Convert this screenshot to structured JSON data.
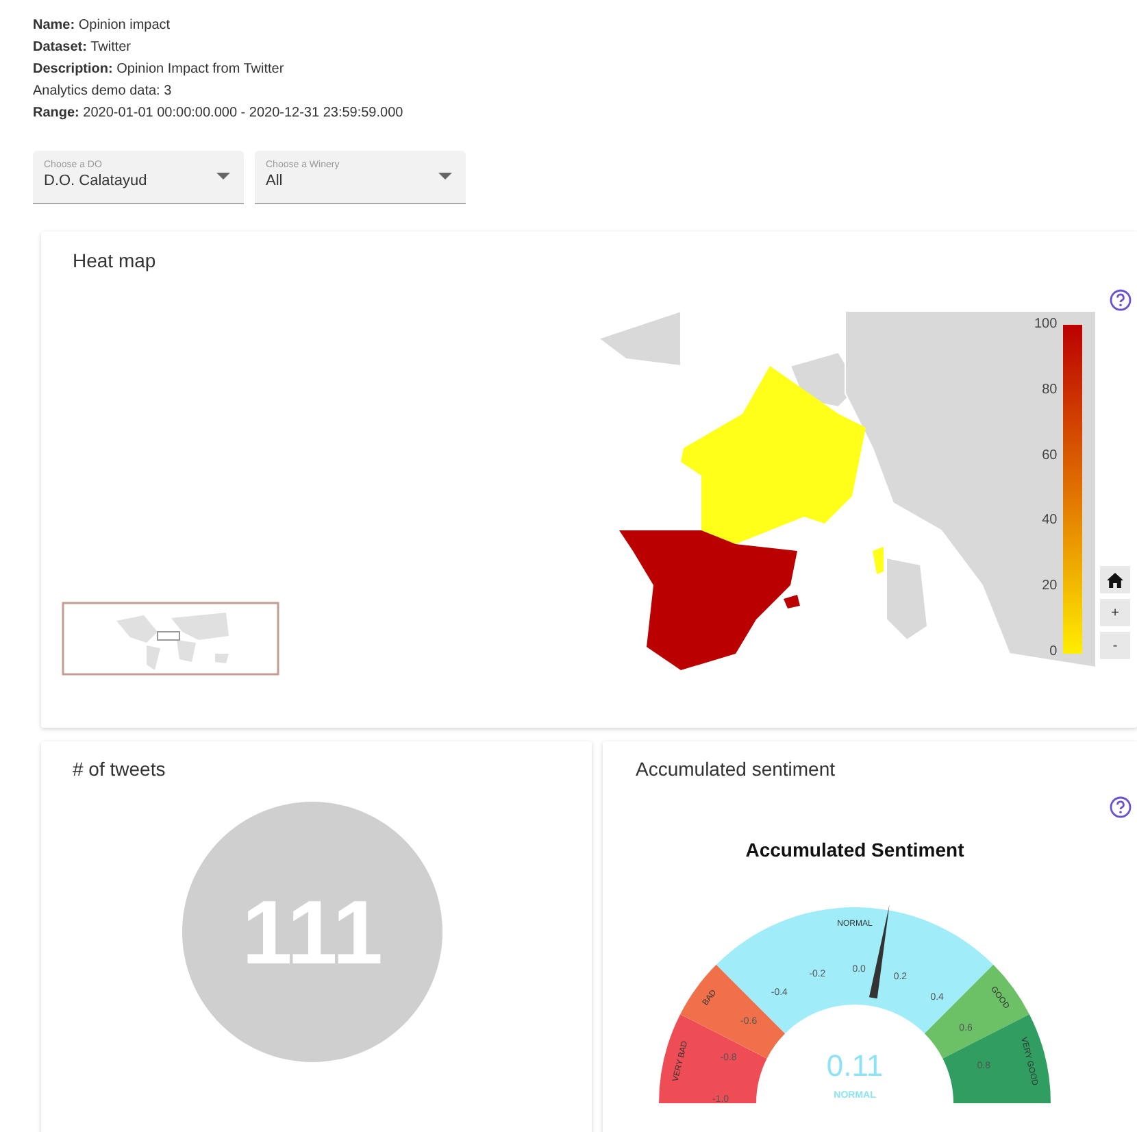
{
  "info": [
    "**Name:** Opinion impact",
    "**Dataset:** Twitter",
    "**Description:** Opinion Impact from Twitter",
    "Analytics demo data: 3",
    "**Range:** 2020-01-01 00:00:00.000 - 2020-12-31 23:59:59.000"
  ],
  "selects": [
    {
      "label": "Choose a DO",
      "value": "D.O. Calatayud"
    },
    {
      "label": "Choose a Winery",
      "value": "All"
    }
  ],
  "heat_map": {
    "title": "Heat map",
    "legend_ticks": [
      "100",
      "80",
      "60",
      "40",
      "20",
      "0"
    ],
    "regions": [
      {
        "color": "#ffff1a"
      },
      {
        "color": "#bb0000"
      }
    ],
    "zoom_buttons": [
      "+",
      "-"
    ]
  },
  "tweets": {
    "title": "# of tweets",
    "count": "111"
  },
  "sentiment": {
    "title": "Accumulated sentiment",
    "gauge": {
      "title": "Accumulated Sentiment",
      "value": "0.11",
      "status": "NORMAL",
      "bands": [
        {
          "label": "VERY BAD",
          "color": "#ee4d55"
        },
        {
          "label": "BAD",
          "color": "#f0704a"
        },
        {
          "label": "NORMAL",
          "color": "#a0ecf9"
        },
        {
          "label": "GOOD",
          "color": "#6cc066"
        },
        {
          "label": "VERY GOOD",
          "color": "#2f9e60"
        }
      ],
      "ticks": [
        "-1.0",
        "-0.8",
        "-0.6",
        "-0.4",
        "-0.2",
        "0.0",
        "0.2",
        "0.4",
        "0.6",
        "0.8"
      ]
    }
  }
}
